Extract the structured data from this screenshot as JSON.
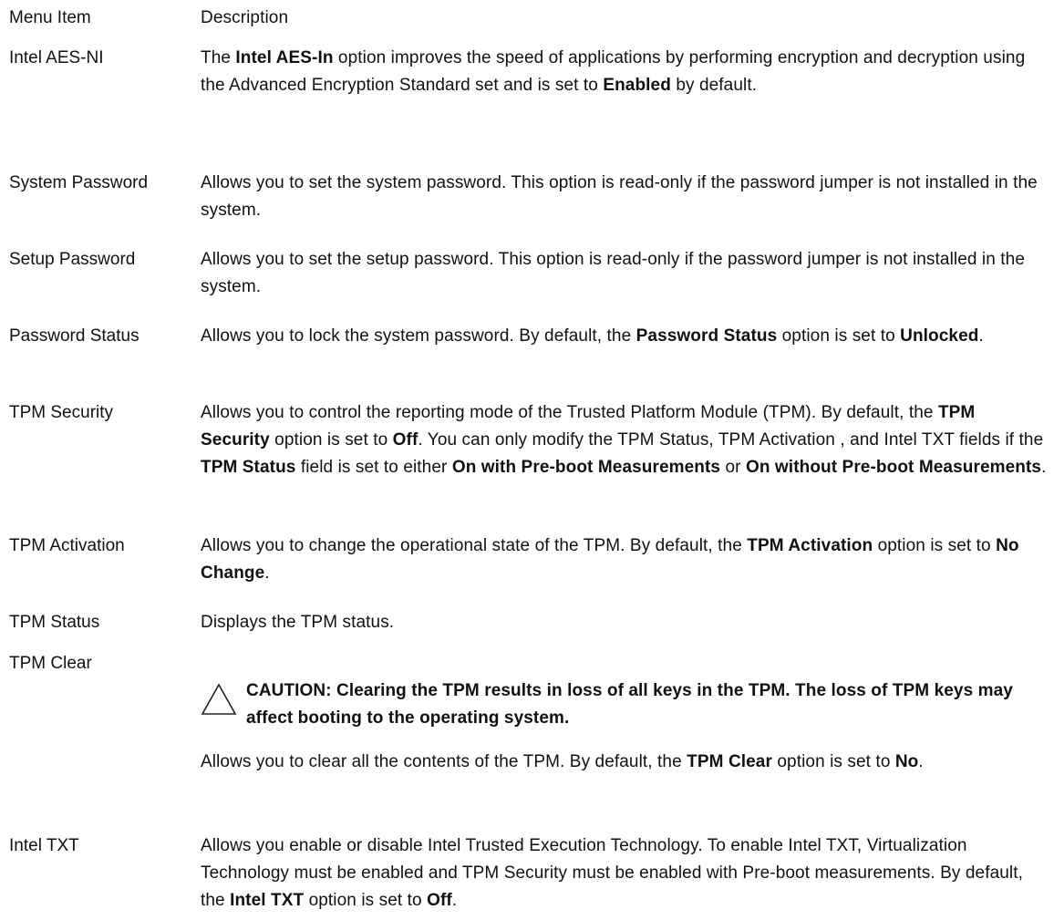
{
  "header": {
    "menu_item": "Menu Item",
    "description": "Description"
  },
  "rows": [
    {
      "item": "Intel AES-NI",
      "desc": [
        {
          "t": "The "
        },
        {
          "t": "Intel AES-In",
          "b": true
        },
        {
          "t": " option improves the speed of applications by performing encryption and decryption using the Advanced Encryption Standard set and is set to "
        },
        {
          "t": "Enabled",
          "b": true
        },
        {
          "t": " by default."
        }
      ]
    },
    {
      "item": "System Password",
      "desc": [
        {
          "t": "Allows you to set the system password. This option is read-only if the password jumper is not installed in the system."
        }
      ]
    },
    {
      "item": "Setup Password",
      "desc": [
        {
          "t": "Allows you to set the setup password. This option is read-only if the password jumper is not installed in the system."
        }
      ]
    },
    {
      "item": "Password Status",
      "desc": [
        {
          "t": "Allows you to lock the system password. By default, the "
        },
        {
          "t": "Password Status",
          "b": true
        },
        {
          "t": " option is set to "
        },
        {
          "t": "Unlocked",
          "b": true
        },
        {
          "t": "."
        }
      ]
    },
    {
      "item": "TPM Security",
      "desc": [
        {
          "t": "Allows you to control the reporting mode of the Trusted Platform Module (TPM). By default, the "
        },
        {
          "t": "TPM Security",
          "b": true
        },
        {
          "t": " option is set to "
        },
        {
          "t": "Off",
          "b": true
        },
        {
          "t": ". You can only modify the TPM Status, TPM Activation , and Intel TXT fields if the "
        },
        {
          "t": "TPM Status",
          "b": true
        },
        {
          "t": " field is set to either "
        },
        {
          "t": "On with Pre-boot Measurements",
          "b": true
        },
        {
          "t": " or "
        },
        {
          "t": "On without Pre-boot Measurements",
          "b": true
        },
        {
          "t": "."
        }
      ]
    },
    {
      "item": "TPM Activation",
      "desc": [
        {
          "t": "Allows you to change the operational state of the TPM. By default, the "
        },
        {
          "t": "TPM Activation",
          "b": true
        },
        {
          "t": " option is set to "
        },
        {
          "t": "No Change",
          "b": true
        },
        {
          "t": "."
        }
      ]
    },
    {
      "item": "TPM Status",
      "desc": [
        {
          "t": "Displays the TPM status."
        }
      ]
    },
    {
      "item": "TPM Clear",
      "caution": "CAUTION: Clearing the TPM results in loss of all keys in the TPM. The loss of TPM keys may affect booting to the operating system.",
      "desc": [
        {
          "t": "Allows you to clear all the contents of the TPM. By default, the "
        },
        {
          "t": "TPM Clear",
          "b": true
        },
        {
          "t": " option is set to "
        },
        {
          "t": "No",
          "b": true
        },
        {
          "t": "."
        }
      ]
    },
    {
      "item": "Intel TXT",
      "desc": [
        {
          "t": "Allows you enable or disable Intel Trusted Execution Technology. To enable Intel TXT, Virtualization Technology must be enabled and TPM Security must be enabled with Pre-boot measurements. By default, the "
        },
        {
          "t": "Intel TXT",
          "b": true
        },
        {
          "t": " option is set to "
        },
        {
          "t": "Off",
          "b": true
        },
        {
          "t": "."
        }
      ]
    }
  ],
  "icons": {
    "caution": "warning-triangle-icon"
  }
}
